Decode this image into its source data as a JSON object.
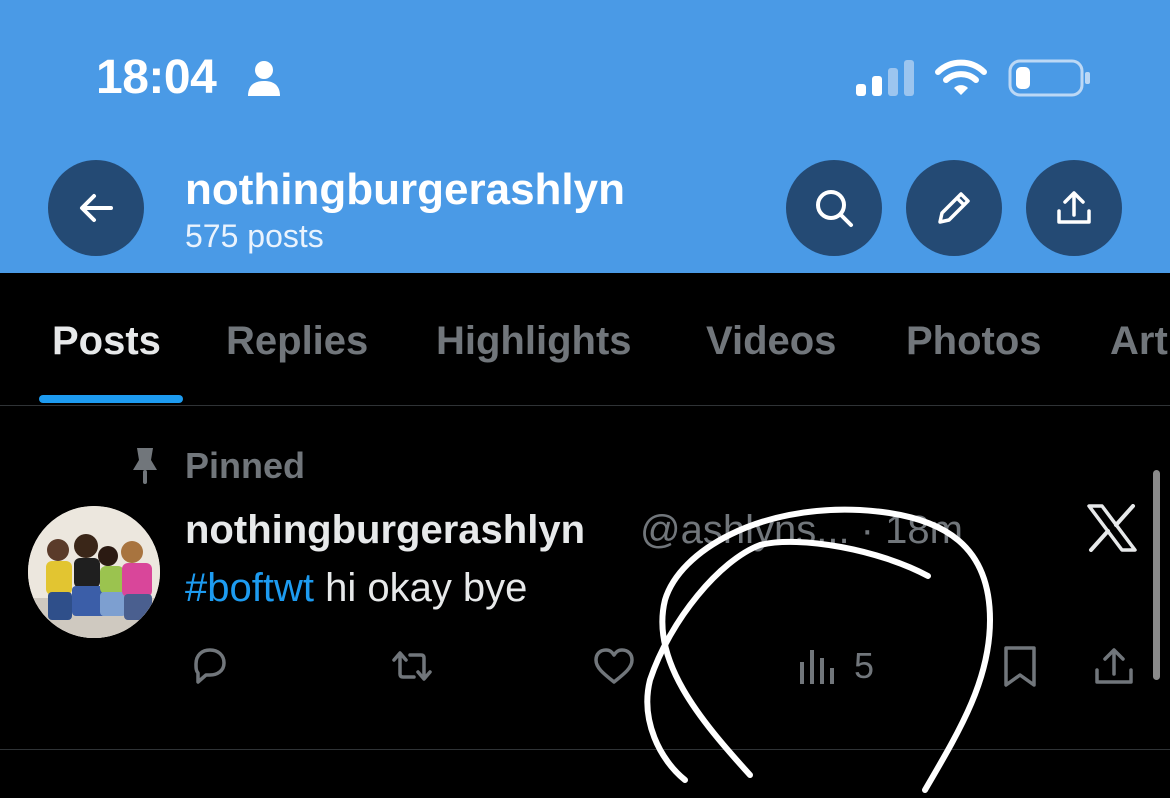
{
  "status_bar": {
    "time": "18:04",
    "icons": [
      "person-icon",
      "cellular-signal-icon",
      "wifi-icon",
      "battery-icon"
    ]
  },
  "header": {
    "profile_name": "nothingburgerashlyn",
    "post_count": "575 posts",
    "buttons": [
      "back-arrow-icon",
      "search-icon",
      "edit-pencil-icon",
      "share-upload-icon"
    ]
  },
  "tabs": [
    {
      "label": "Posts",
      "active": true
    },
    {
      "label": "Replies",
      "active": false
    },
    {
      "label": "Highlights",
      "active": false
    },
    {
      "label": "Videos",
      "active": false
    },
    {
      "label": "Photos",
      "active": false
    },
    {
      "label": "Art",
      "active": false
    }
  ],
  "post": {
    "pinned_label": "Pinned",
    "author_name": "nothingburgerashlyn",
    "handle_time": "@ashlyns... · 18m",
    "hashtag": "#boftwt",
    "text": " hi okay bye",
    "views": "5",
    "actions": [
      "reply-icon",
      "repost-icon",
      "like-icon",
      "views-icon",
      "bookmark-icon",
      "share-icon"
    ]
  },
  "colors": {
    "header_bg": "#4a9ae6",
    "header_button_bg": "#244a74",
    "accent": "#1d9bf0",
    "background": "#000000",
    "muted_text": "#71767b"
  }
}
